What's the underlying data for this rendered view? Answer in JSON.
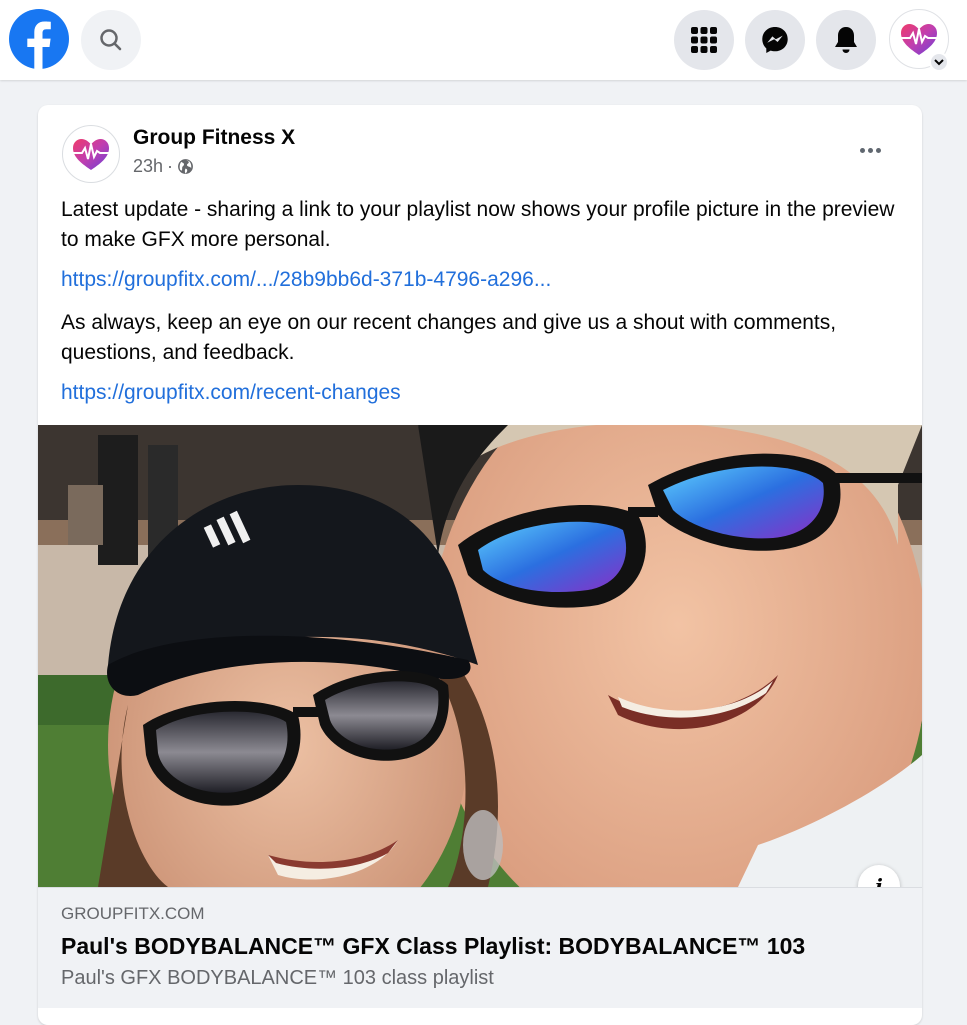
{
  "header": {
    "logo_icon": "facebook-logo-icon",
    "search_icon": "search-icon",
    "menu_icon": "grid-menu-icon",
    "messenger_icon": "messenger-icon",
    "notifications_icon": "bell-icon",
    "profile_icon": "profile-avatar-icon",
    "brand_color": "#1877f2"
  },
  "post": {
    "page_name": "Group Fitness X",
    "time": "23h",
    "separator": "·",
    "audience_icon": "globe-icon",
    "more_icon": "more-options-icon",
    "paragraph_1": "Latest update - sharing a link to your playlist now shows your profile picture in the preview to make GFX more personal.",
    "link_1": "https://groupfitx.com/.../28b9bb6d-371b-4796-a296...",
    "paragraph_2": "As always, keep an eye on our recent changes and give us a shout with comments, questions, and feedback.",
    "link_2": "https://groupfitx.com/recent-changes",
    "link_color": "#216fdb"
  },
  "preview": {
    "image_description_icon": "selfie-photo",
    "info_label": "i",
    "domain": "GROUPFITX.COM",
    "title": "Paul's BODYBALANCE™ GFX Class Playlist: BODYBALANCE™ 103",
    "description": "Paul's GFX BODYBALANCE™ 103 class playlist"
  }
}
